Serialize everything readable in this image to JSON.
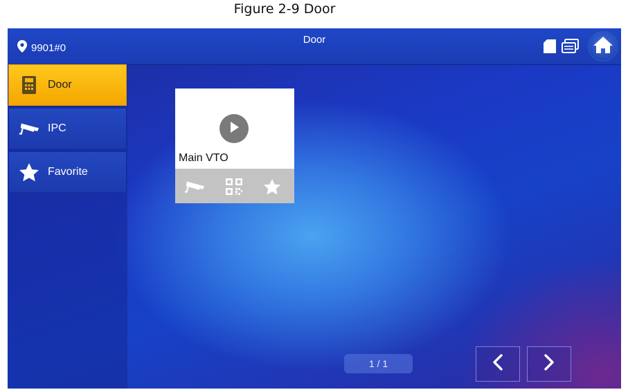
{
  "caption": "Figure 2-9 Door",
  "header": {
    "location": "9901#0",
    "title": "Door",
    "icons": [
      "location-pin-icon",
      "sd-card-icon",
      "message-icon",
      "home-icon"
    ]
  },
  "sidebar": {
    "items": [
      {
        "label": "Door",
        "icon": "door-panel-icon",
        "active": true
      },
      {
        "label": "IPC",
        "icon": "camera-icon",
        "active": false
      },
      {
        "label": "Favorite",
        "icon": "star-icon",
        "active": false
      }
    ]
  },
  "device_card": {
    "name": "Main VTO",
    "actions": [
      "camera-icon",
      "qr-code-icon",
      "star-icon"
    ]
  },
  "pagination": {
    "label": "1 / 1"
  },
  "colors": {
    "accent": "#f7b20a",
    "header": "#1f47c6",
    "background": "#1b3cb4"
  }
}
